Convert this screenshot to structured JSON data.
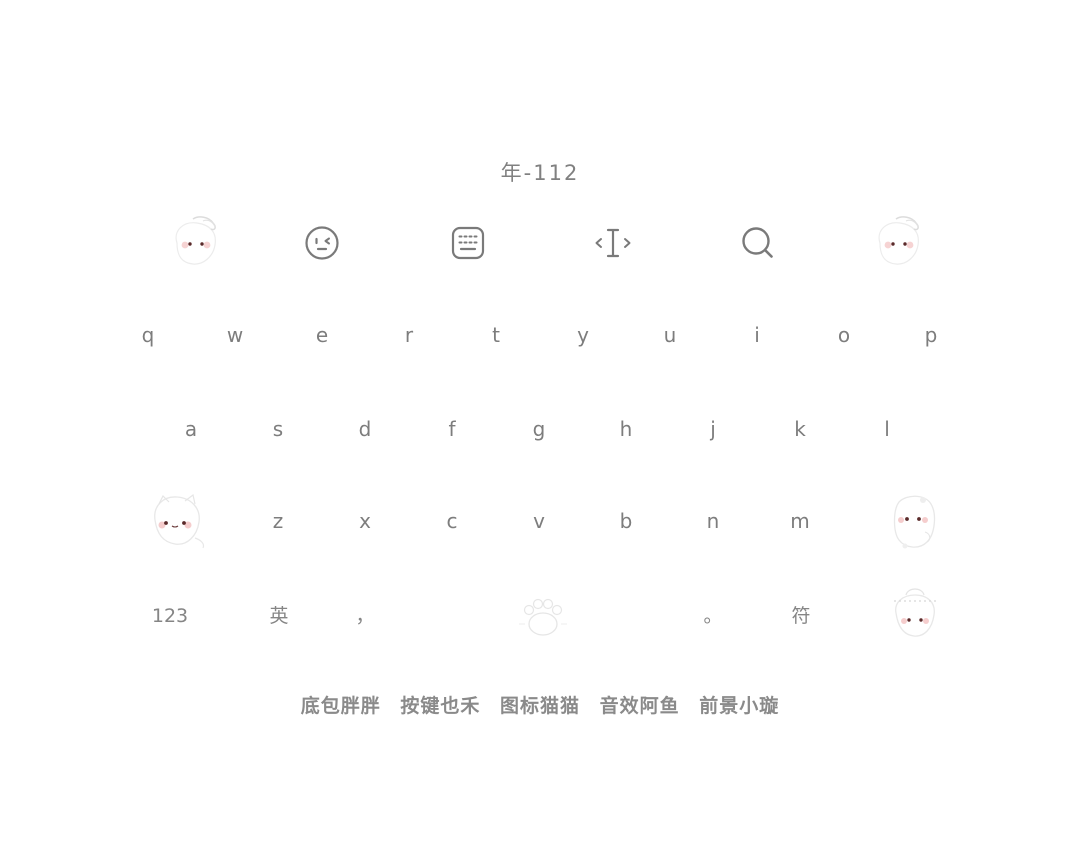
{
  "title": "年-112",
  "toolbar": {
    "items": [
      {
        "name": "cat-sticker-left",
        "icon": "cat-mascot-icon"
      },
      {
        "name": "emoji",
        "icon": "emoji-face-icon"
      },
      {
        "name": "keyboard-layout",
        "icon": "keyboard-icon"
      },
      {
        "name": "cursor",
        "icon": "text-cursor-icon"
      },
      {
        "name": "search",
        "icon": "search-icon"
      },
      {
        "name": "cat-sticker-right",
        "icon": "cat-mascot-icon"
      }
    ]
  },
  "keyboard": {
    "row1": [
      "q",
      "w",
      "e",
      "r",
      "t",
      "y",
      "u",
      "i",
      "o",
      "p"
    ],
    "row2": [
      "a",
      "s",
      "d",
      "f",
      "g",
      "h",
      "j",
      "k",
      "l"
    ],
    "row3": [
      "z",
      "x",
      "c",
      "v",
      "b",
      "n",
      "m"
    ],
    "row4": {
      "numbers": "123",
      "lang": "英",
      "comma": "，",
      "period": "。",
      "symbols": "符"
    }
  },
  "footer": {
    "items": [
      "底包胖胖",
      "按键也禾",
      "图标猫猫",
      "音效阿鱼",
      "前景小璇"
    ]
  },
  "colors": {
    "text": "#7d7d7d",
    "background": "#ffffff",
    "mascot_eye": "#5a2a2a",
    "mascot_blush": "#f3c4c4"
  }
}
